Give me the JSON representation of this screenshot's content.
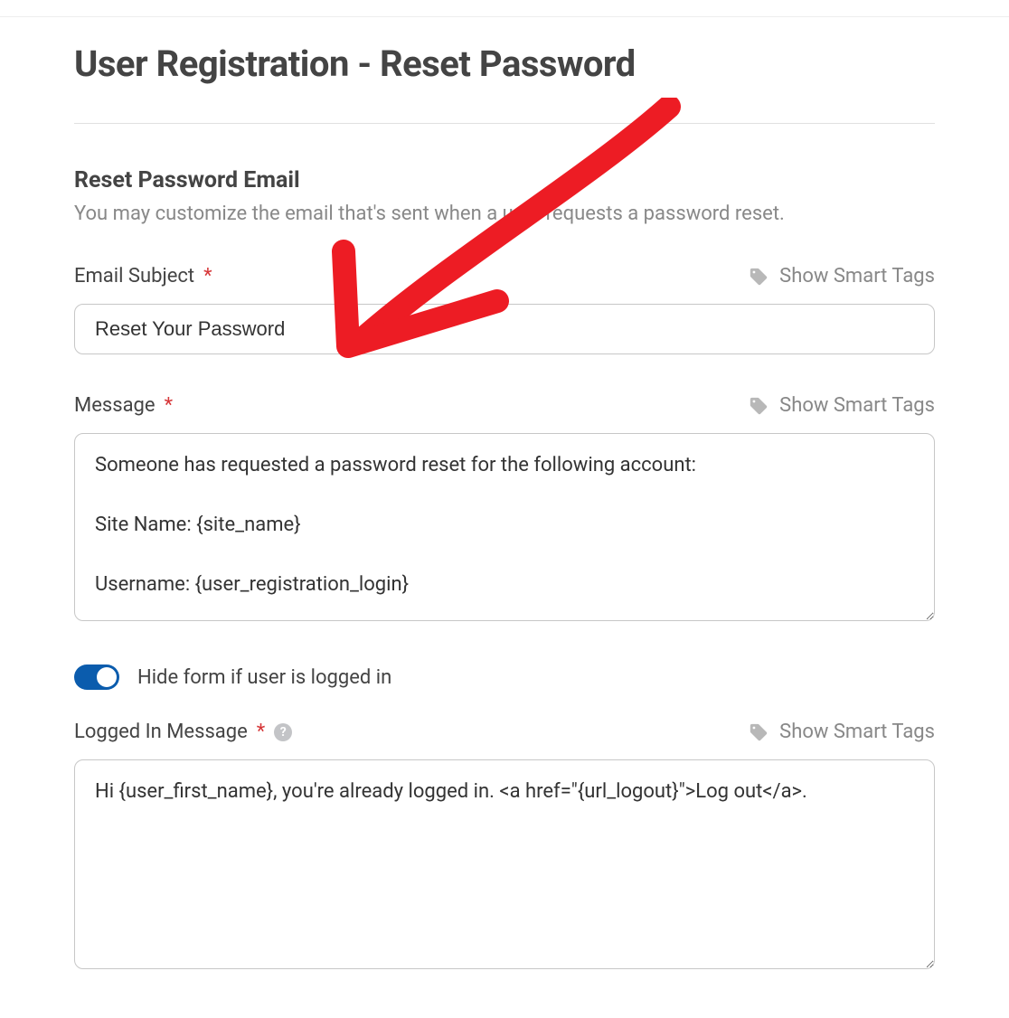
{
  "pageTitle": "User Registration - Reset Password",
  "section": {
    "title": "Reset Password Email",
    "description": "You may customize the email that's sent when a user requests a password reset."
  },
  "smartTagsLabel": "Show Smart Tags",
  "emailSubject": {
    "label": "Email Subject",
    "value": "Reset Your Password"
  },
  "message": {
    "label": "Message",
    "value": "Someone has requested a password reset for the following account:\n\nSite Name: {site_name}\n\nUsername: {user_registration_login}"
  },
  "hideToggle": {
    "label": "Hide form if user is logged in",
    "enabled": true
  },
  "loggedInMessage": {
    "label": "Logged In Message",
    "value": "Hi {user_first_name}, you're already logged in. <a href=\"{url_logout}\">Log out</a>."
  },
  "requiredMark": "*"
}
